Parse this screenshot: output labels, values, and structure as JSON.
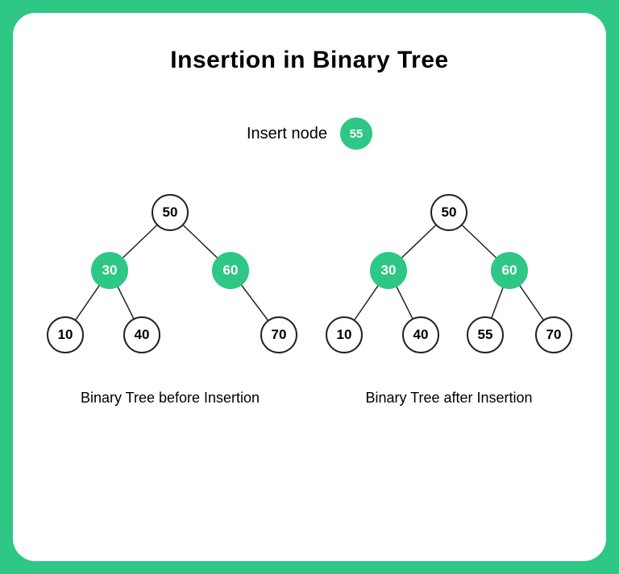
{
  "title": "Insertion in Binary Tree",
  "insert": {
    "label": "Insert node",
    "value": "55"
  },
  "trees": {
    "before": {
      "caption": "Binary Tree before Insertion",
      "root": "50",
      "l1_left": "30",
      "l1_right": "60",
      "l2_a": "10",
      "l2_b": "40",
      "l2_d": "70"
    },
    "after": {
      "caption": "Binary Tree after Insertion",
      "root": "50",
      "l1_left": "30",
      "l1_right": "60",
      "l2_a": "10",
      "l2_b": "40",
      "l2_c": "55",
      "l2_d": "70"
    }
  },
  "colors": {
    "accent": "#2ec786"
  }
}
